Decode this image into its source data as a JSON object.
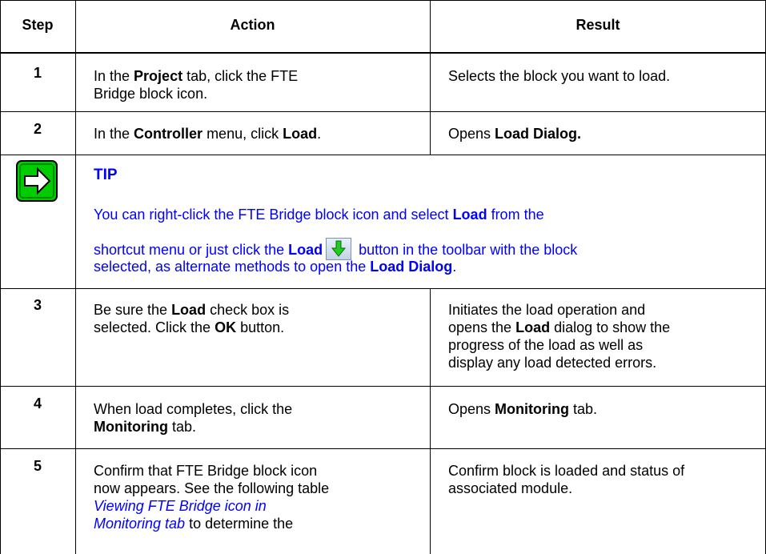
{
  "table": {
    "headers": {
      "step": "Step",
      "action": "Action",
      "result": "Result"
    },
    "rows": [
      {
        "step": "1",
        "action": [
          "In the ",
          "Project",
          " tab, click the FTE",
          "Bridge block icon."
        ],
        "result": "Selects the block you want to load."
      },
      {
        "step": "2",
        "action": [
          "In the ",
          "Controller",
          " menu, click ",
          "Load",
          "."
        ],
        "result": [
          "Opens ",
          "Load Dialog."
        ]
      },
      {
        "step": "3",
        "action": [
          "Be sure the ",
          "Load",
          " check box is",
          "selected. Click the ",
          "OK",
          " button."
        ],
        "result": [
          "Initiates the load operation and",
          "opens the ",
          "Load",
          " dialog to show the",
          "progress of the load as well as",
          "display any load detected errors."
        ]
      },
      {
        "step": "4",
        "action": [
          "When load completes, click the",
          "Monitoring",
          " tab."
        ],
        "result": [
          "Opens ",
          "Monitoring",
          " tab."
        ]
      },
      {
        "step": "5",
        "action": [
          "Confirm that FTE Bridge block icon",
          "now appears. See the following table",
          "Viewing FTE Bridge icon in",
          "Monitoring tab",
          " to determine the"
        ],
        "result": [
          "Confirm block is loaded and status of",
          "associated module."
        ]
      }
    ]
  },
  "tip": {
    "title": "TIP",
    "line1_pre": "You can right-click the FTE Bridge block icon and select ",
    "line1_bold": "Load",
    "line1_post": " from the",
    "line2_pre": "shortcut menu or just click the ",
    "line2_bold": "Load",
    "line2_post": " button in the toolbar with the block",
    "line3_pre": "selected, as alternate methods to open the ",
    "line3_bold": "Load Dialog",
    "line3_post": "."
  },
  "icons": {
    "tip": "right-arrow-icon",
    "load": "load-down-arrow-icon"
  },
  "colors": {
    "tip_text": "#0000ff",
    "tip_icon_bg": "#00cc00"
  }
}
